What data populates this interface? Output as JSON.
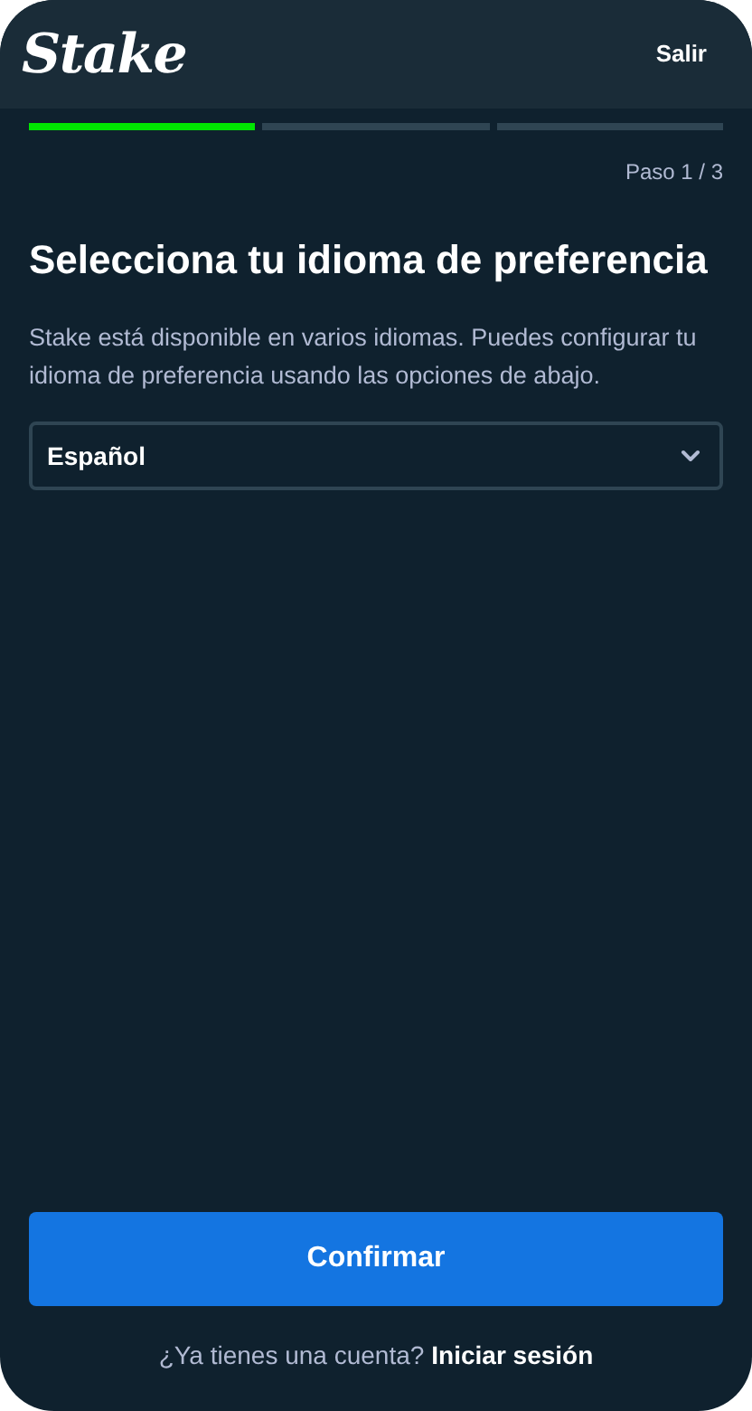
{
  "header": {
    "logo": "Stake",
    "exit": "Salir"
  },
  "steps": [
    {
      "done": true
    },
    {
      "done": false
    },
    {
      "done": false
    }
  ],
  "step_label": "Paso 1 / 3",
  "title": "Selecciona tu idioma de preferencia",
  "description": "Stake está disponible en varios idiomas. Puedes configurar tu idioma de preferencia usando las opciones de abajo.",
  "language_select": {
    "value": "Español"
  },
  "confirm_button": "Confirmar",
  "footer": {
    "prompt": "¿Ya tienes una cuenta?",
    "link": "Iniciar sesión"
  }
}
